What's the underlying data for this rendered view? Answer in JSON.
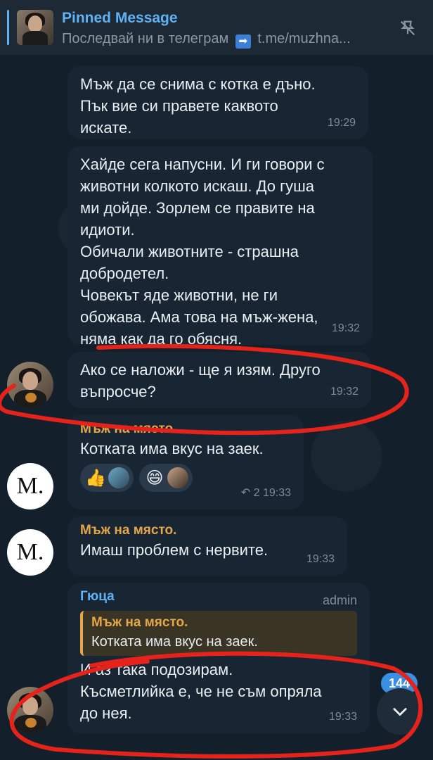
{
  "pinned": {
    "title": "Pinned Message",
    "preview_text": "Последвай ни в телеграм",
    "preview_emoji": "➡",
    "preview_link": "t.me/muzhna..."
  },
  "messages": [
    {
      "text": "Мъж да се снима с котка е дъно.\nПък вие си правете каквото\nискате.",
      "time": "19:29"
    },
    {
      "text": "Хайде сега напусни. И ги говори с\nживотни колкото искаш. До гуша\nми дойде. Зорлем се правите на\nидиоти.\nОбичали животните - страшна\nдобродетел.\nЧовекът яде животни, не ги\nобожава. Ама това на мъж-жена,\nняма как да го обясня.",
      "time": "19:32"
    },
    {
      "text": "Ако се наложи - ще я изям. Друго\nвъпросче?",
      "time": "19:32"
    },
    {
      "sender": "Мъж на място.",
      "text": "Котката има вкус на заек.",
      "reactions": [
        "👍",
        "😄"
      ],
      "replies": "2",
      "time": "19:33",
      "avatar_letter": "M."
    },
    {
      "sender": "Мъж на място.",
      "text": "Имаш проблем с нервите.",
      "time": "19:33",
      "avatar_letter": "M."
    },
    {
      "sender": "Гюца",
      "role": "admin",
      "quote_name": "Мъж на място.",
      "quote_text": "Котката има вкус на заек.",
      "text": "И аз така подозирам.\nКъсметлийка е, че не съм опряла\nдо нея.",
      "time": "19:33"
    }
  ],
  "unread_count": "144",
  "colors": {
    "background": "#13202b",
    "bubble": "#182533",
    "accent_blue": "#5fb3f5",
    "sender_orange": "#e6a74a",
    "annotation_red": "#e5231b"
  },
  "icons": {
    "unpin": "unpin-icon",
    "reply": "reply-arrow-icon",
    "scroll_down": "chevron-down-icon"
  }
}
